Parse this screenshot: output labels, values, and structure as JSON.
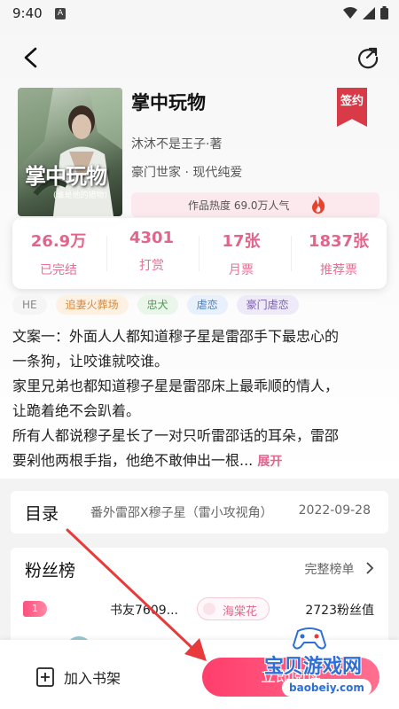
{
  "status_bar": {
    "time": "9:40",
    "a_icon": "A"
  },
  "book": {
    "title": "掌中玩物",
    "sign_badge": "签约",
    "author": "沐沐不是王子·著",
    "genre": "豪门世家 · 现代纯爱",
    "heat": "作品热度 69.0万人气",
    "cover_title": "掌中玩物",
    "cover_subtitle": "(谁是他的猎物)"
  },
  "stats": [
    {
      "value": "26.9万",
      "label": "已完结"
    },
    {
      "value": "4301",
      "label": "打赏"
    },
    {
      "value": "17张",
      "label": "月票"
    },
    {
      "value": "1837张",
      "label": "推荐票"
    }
  ],
  "tags": [
    {
      "label": "HE",
      "bg": "#f5f5f5",
      "color": "#888888"
    },
    {
      "label": "追妻火葬场",
      "bg": "#fdf1e4",
      "color": "#d58a3c"
    },
    {
      "label": "忠犬",
      "bg": "#e9f6e9",
      "color": "#4f9a55"
    },
    {
      "label": "虐恋",
      "bg": "#e8f0fb",
      "color": "#4a7cc0"
    },
    {
      "label": "豪门虐恋",
      "bg": "#efeaf8",
      "color": "#7a5fb0"
    }
  ],
  "synopsis": {
    "lines": [
      "文案一：外面人人都知道穆子星是雷邵手下最忠心的",
      "一条狗，让咬谁就咬谁。",
      "家里兄弟也都知道穆子星是雷邵床上最乖顺的情人，",
      "让跪着绝不会趴着。",
      "所有人都说穆子星长了一对只听雷邵话的耳朵，雷邵",
      "要剁他两根手指，他绝不敢伸出一根..."
    ],
    "expand_label": "展开"
  },
  "catalog": {
    "title": "目录",
    "latest_chapter": "番外雷邵X穆子星（雷小攻视角）",
    "date": "2022-09-28"
  },
  "fans": {
    "title": "粉丝榜",
    "full_list_label": "完整榜单",
    "top": {
      "rank": "1",
      "name": "书友7609...",
      "badge": "海棠花",
      "score": "2723粉丝值"
    }
  },
  "bottom_bar": {
    "add_shelf_label": "加入书架",
    "read_label": "立即阅读"
  },
  "watermark": {
    "text": "宝贝游戏网",
    "url": "baobeiy.com"
  },
  "colors": {
    "accent": "#e0668c",
    "primary_button": "#ff4d7c",
    "sign_badge": "#d83a48",
    "arrow": "#e83a3a"
  }
}
